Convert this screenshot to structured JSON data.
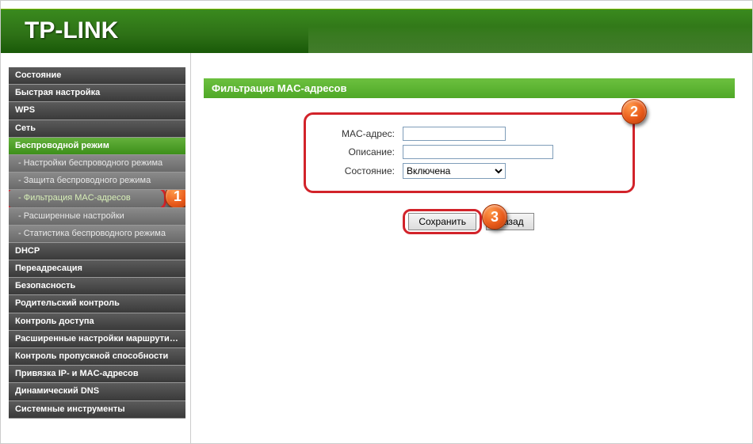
{
  "header": {
    "brand": "TP-LINK"
  },
  "sidebar": {
    "items": [
      {
        "label": "Состояние",
        "type": "top"
      },
      {
        "label": "Быстрая настройка",
        "type": "top"
      },
      {
        "label": "WPS",
        "type": "top"
      },
      {
        "label": "Сеть",
        "type": "top"
      },
      {
        "label": "Беспроводной режим",
        "type": "active"
      },
      {
        "label": "- Настройки беспроводного режима",
        "type": "sub"
      },
      {
        "label": "- Защита беспроводного режима",
        "type": "sub"
      },
      {
        "label": "- Фильтрация MAC-адресов",
        "type": "sub-selected"
      },
      {
        "label": "- Расширенные настройки",
        "type": "sub"
      },
      {
        "label": "- Статистика беспроводного режима",
        "type": "sub"
      },
      {
        "label": "DHCP",
        "type": "top"
      },
      {
        "label": "Переадресация",
        "type": "top"
      },
      {
        "label": "Безопасность",
        "type": "top"
      },
      {
        "label": "Родительский контроль",
        "type": "top"
      },
      {
        "label": "Контроль доступа",
        "type": "top"
      },
      {
        "label": "Расширенные настройки маршрутизации",
        "type": "top"
      },
      {
        "label": "Контроль пропускной способности",
        "type": "top"
      },
      {
        "label": "Привязка IP- и MAC-адресов",
        "type": "top"
      },
      {
        "label": "Динамический DNS",
        "type": "top"
      },
      {
        "label": "Системные инструменты",
        "type": "top"
      }
    ]
  },
  "content": {
    "title": "Фильтрация MAC-адресов",
    "form": {
      "mac_label": "MAC-адрес:",
      "mac_value": "",
      "desc_label": "Описание:",
      "desc_value": "",
      "state_label": "Состояние:",
      "state_value": "Включена"
    },
    "buttons": {
      "save": "Сохранить",
      "back": "Назад"
    }
  },
  "badges": {
    "b1": "1",
    "b2": "2",
    "b3": "3"
  }
}
